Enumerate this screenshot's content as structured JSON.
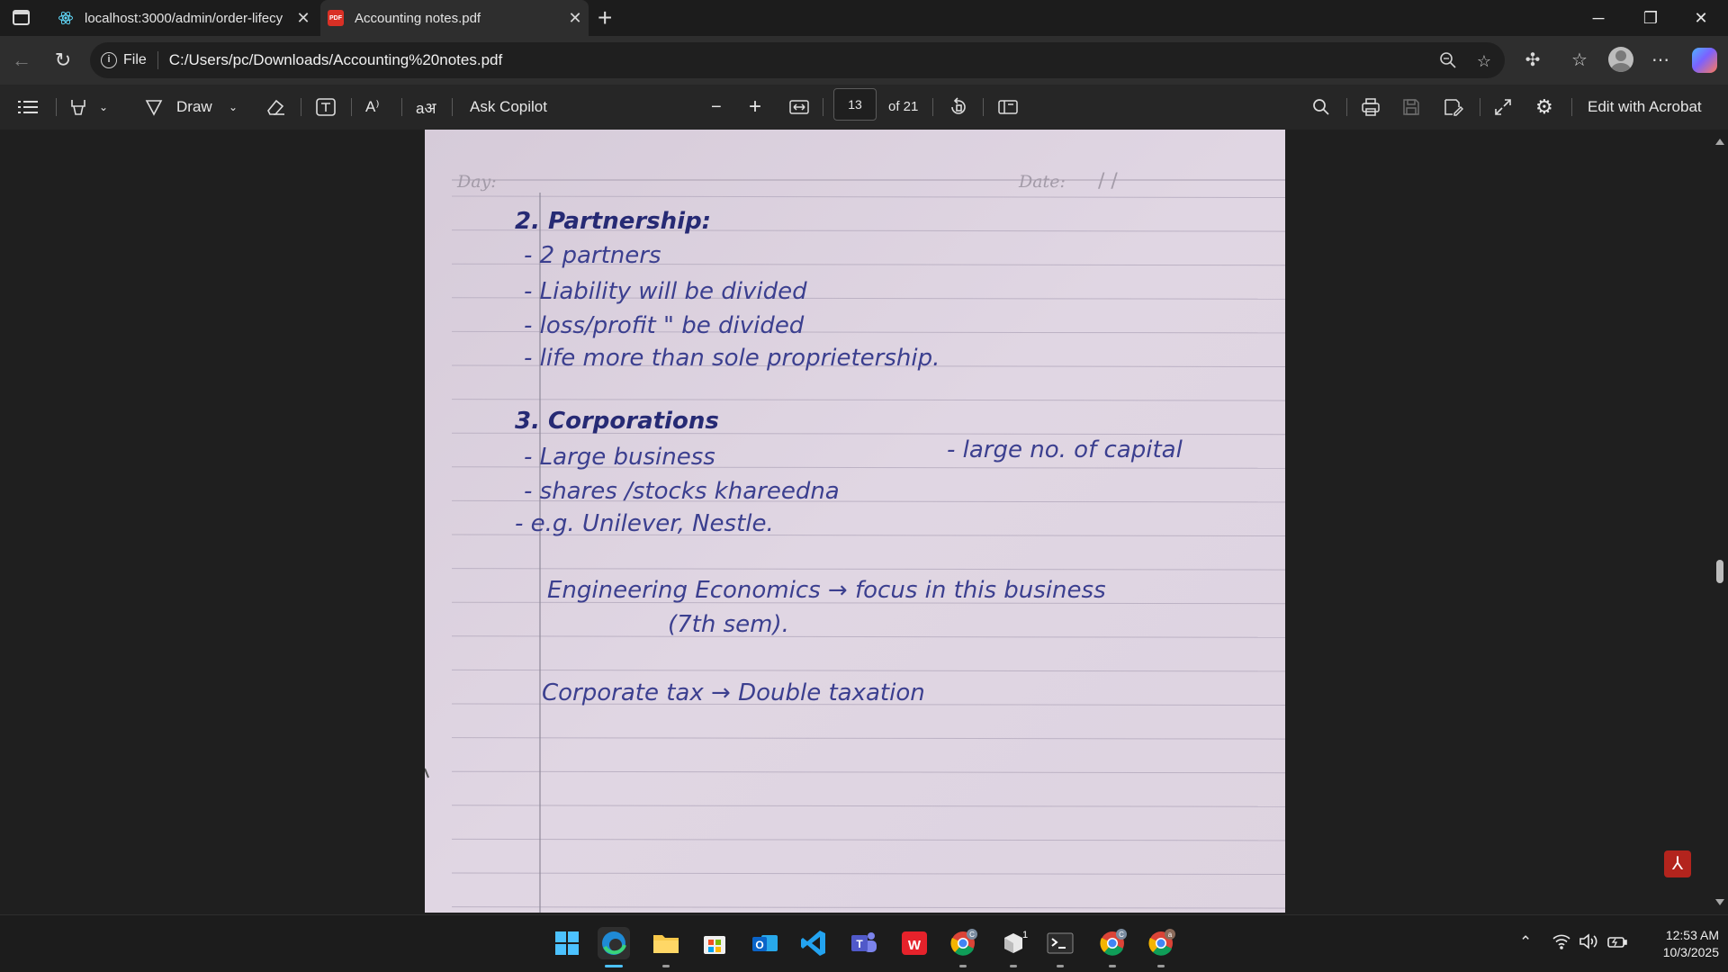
{
  "browser": {
    "tabs": [
      {
        "title": "localhost:3000/admin/order-lifecy",
        "favicon": "react-icon",
        "active": false
      },
      {
        "title": "Accounting notes.pdf",
        "favicon": "pdf-icon",
        "active": true
      }
    ],
    "address": {
      "scheme_label": "File",
      "url": "C:/Users/pc/Downloads/Accounting%20notes.pdf"
    }
  },
  "pdf_toolbar": {
    "draw_label": "Draw",
    "copilot_label": "Ask Copilot",
    "read_aloud_label": "A⁾",
    "translate_label": "aअ",
    "page_current": "13",
    "page_total_label": "of 21",
    "edit_label": "Edit with Acrobat"
  },
  "page_content": {
    "header_day": "Day:",
    "header_date": "Date:",
    "date_slashes": "/     /",
    "lines": [
      "2. Partnership:",
      "- 2 partners",
      "- Liability will be divided",
      "- loss/profit \" be divided",
      "- life more than sole proprietership.",
      "3. Corporations",
      "- Large business",
      "- large no. of capital",
      "- shares /stocks khareedna",
      "- e.g. Unilever, Nestle.",
      "Engineering Economics → focus in this business",
      "(7th sem).",
      "Corporate tax → Double taxation"
    ]
  },
  "taskbar": {
    "time": "12:53 AM",
    "date": "10/3/2025",
    "apps": [
      "windows-start-icon",
      "edge-icon",
      "file-explorer-icon",
      "store-icon",
      "outlook-icon",
      "vscode-icon",
      "teams-icon",
      "wps-icon",
      "chrome-icon",
      "app-icon",
      "terminal-icon",
      "chrome-icon",
      "chrome-icon"
    ]
  },
  "colors": {
    "paper": "#ddd3e0",
    "ink": "#3b3f8f",
    "dark_ink": "#262a74",
    "rule_line": "#bcb2c4",
    "margin_line": "#8f8a9a"
  }
}
